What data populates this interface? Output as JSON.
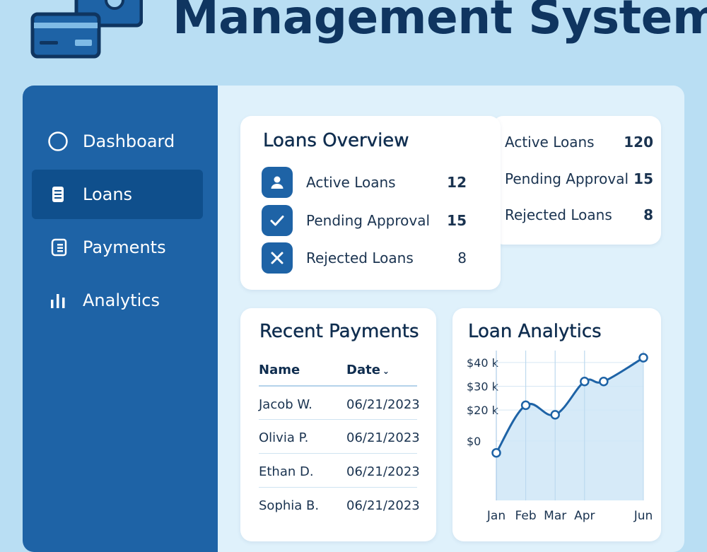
{
  "header": {
    "title": "Management System"
  },
  "sidebar": {
    "items": [
      {
        "label": "Dashboard",
        "icon": "circle-icon",
        "active": false
      },
      {
        "label": "Loans",
        "icon": "document-icon",
        "active": true
      },
      {
        "label": "Payments",
        "icon": "receipt-icon",
        "active": false
      },
      {
        "label": "Analytics",
        "icon": "bar-chart-icon",
        "active": false
      }
    ]
  },
  "overview": {
    "title": "Loans Overview",
    "rows": [
      {
        "label": "Active Loans",
        "value": "12",
        "icon": "user-icon"
      },
      {
        "label": "Pending Approval",
        "value": "15",
        "icon": "check-icon"
      },
      {
        "label": "Rejected Loans",
        "value": "8",
        "icon": "x-icon"
      }
    ]
  },
  "summary": {
    "rows": [
      {
        "label": "Active Loans",
        "value": "120"
      },
      {
        "label": "Pending Approval",
        "value": "15"
      },
      {
        "label": "Rejected Loans",
        "value": "8"
      }
    ]
  },
  "payments": {
    "title": "Recent Payments",
    "columns": [
      "Name",
      "Date"
    ],
    "rows": [
      {
        "name": "Jacob W.",
        "date": "06/21/2023"
      },
      {
        "name": "Olivia P.",
        "date": "06/21/2023"
      },
      {
        "name": "Ethan D.",
        "date": "06/21/2023"
      },
      {
        "name": "Sophia B.",
        "date": "06/21/2023"
      }
    ]
  },
  "analytics": {
    "title": "Loan Analytics"
  },
  "colors": {
    "primary": "#1e63a6",
    "sidebar_active": "#0f4f8c",
    "background": "#b9def3",
    "chart_line": "#1e63a6",
    "chart_fill": "#cfe6f7"
  },
  "chart_data": {
    "type": "area",
    "categories": [
      "Jan",
      "Feb",
      "Mar",
      "Apr",
      "Jun"
    ],
    "x": [
      0,
      1,
      2,
      3,
      3.65,
      5
    ],
    "values": [
      2,
      22,
      18,
      32,
      32,
      42
    ],
    "xticks": [
      "Jan",
      "Feb",
      "Mar",
      "Apr",
      "Jun"
    ],
    "xtick_positions": [
      0,
      1,
      2,
      3,
      5
    ],
    "yticks": [
      "$0",
      "$20 k",
      "$30 k",
      "$40 k"
    ],
    "ytick_values": [
      7,
      20,
      30,
      40
    ],
    "ylim": [
      -18,
      45
    ],
    "grid": true
  }
}
